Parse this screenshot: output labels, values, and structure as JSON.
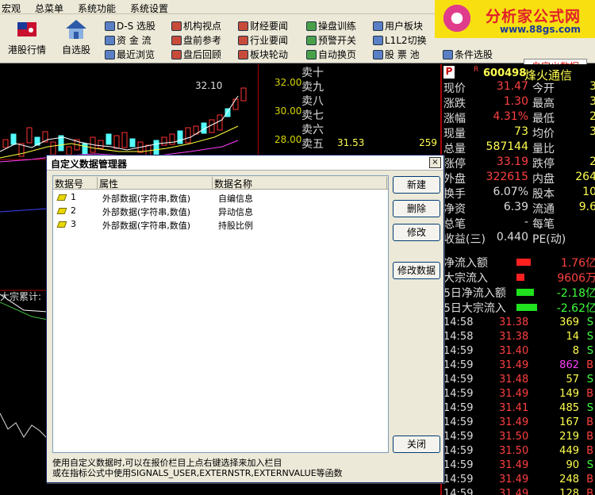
{
  "menu": [
    "宏观",
    "总菜单",
    "系统功能",
    "系统设置"
  ],
  "toolbar": {
    "big": [
      {
        "label": "港股行情",
        "icon": "hk-flag-icon"
      },
      {
        "label": "自选股",
        "icon": "house-icon"
      }
    ],
    "cells": [
      [
        "D-S 选股",
        "机构视点",
        "财经要闻",
        "操盘训练",
        "用户板块"
      ],
      [
        "资 金 流",
        "盘前参考",
        "行业要闻",
        "预警开关",
        "L1L2切换"
      ],
      [
        "最近浏览",
        "盘后回顾",
        "板块轮动",
        "自动换页",
        "股 票 池"
      ]
    ],
    "conditional": "条件选股",
    "custom": "自定义数据"
  },
  "logo": {
    "main": "分析家公式网",
    "url": "www.88gs.com"
  },
  "chart": {
    "price_labels": [
      "32.00",
      "30.00",
      "28.00"
    ],
    "peak_label": "32.10",
    "side_label": "大宗累计:"
  },
  "orderbook": {
    "levels": [
      "卖十",
      "卖九",
      "卖八",
      "卖七",
      "卖六",
      "卖五"
    ],
    "sell5_price": "31.53",
    "sell5_vol": "259"
  },
  "quote": {
    "badge": "P",
    "r": "R",
    "code": "600498",
    "name": "烽火通信",
    "rows": [
      {
        "k": "现价",
        "v": "31.47",
        "c": "#ff4040",
        "k2": "今开",
        "v2": "3"
      },
      {
        "k": "涨跌",
        "v": "1.30",
        "c": "#ff4040",
        "k2": "最高",
        "v2": "3"
      },
      {
        "k": "涨幅",
        "v": "4.31%",
        "c": "#ff4040",
        "k2": "最低",
        "v2": "2"
      },
      {
        "k": "现量",
        "v": "73",
        "c": "#ffff50",
        "k2": "均价",
        "v2": "3"
      },
      {
        "k": "总量",
        "v": "587144",
        "c": "#ffff50",
        "k2": "量比",
        "v2": ""
      },
      {
        "k": "涨停",
        "v": "33.19",
        "c": "#ff4040",
        "k2": "跌停",
        "v2": "2"
      },
      {
        "k": "外盘",
        "v": "322615",
        "c": "#ff4040",
        "k2": "内盘",
        "v2": "264"
      }
    ],
    "rows2": [
      {
        "k": "换手",
        "v": "6.07%",
        "c": "#ddd",
        "k2": "股本",
        "v2": "10"
      },
      {
        "k": "净资",
        "v": "6.39",
        "c": "#ddd",
        "k2": "流通",
        "v2": "9.6"
      },
      {
        "k": "总笔",
        "v": "-",
        "c": "#ddd",
        "k2": "每笔",
        "v2": ""
      },
      {
        "k": "收益(三)",
        "v": "0.440",
        "c": "#ddd",
        "k2": "PE(动)",
        "v2": ""
      }
    ],
    "flows": [
      {
        "k": "净流入额",
        "v": "1.76亿",
        "c": "#ff4040",
        "bar": "#ff2020",
        "w": 18
      },
      {
        "k": "大宗流入",
        "v": "9606万",
        "c": "#ff4040",
        "bar": "#ff2020",
        "w": 10
      },
      {
        "k": "5日净流入额",
        "v": "-2.18亿",
        "c": "#40ff40",
        "bar": "#20e020",
        "w": 22
      },
      {
        "k": "5日大宗流入",
        "v": "-2.62亿",
        "c": "#40ff40",
        "bar": "#20e020",
        "w": 26
      }
    ],
    "ticks": [
      {
        "t": "14:58",
        "p": "31.38",
        "q": "369",
        "s": "S"
      },
      {
        "t": "14:58",
        "p": "31.38",
        "q": "14",
        "s": "S"
      },
      {
        "t": "14:59",
        "p": "31.40",
        "q": "8",
        "s": "S"
      },
      {
        "t": "14:59",
        "p": "31.49",
        "q": "862",
        "s": "B"
      },
      {
        "t": "14:59",
        "p": "31.48",
        "q": "57",
        "s": "S"
      },
      {
        "t": "14:59",
        "p": "31.49",
        "q": "149",
        "s": "B"
      },
      {
        "t": "14:59",
        "p": "31.41",
        "q": "485",
        "s": "S"
      },
      {
        "t": "14:59",
        "p": "31.49",
        "q": "167",
        "s": "B"
      },
      {
        "t": "14:59",
        "p": "31.50",
        "q": "219",
        "s": "B"
      },
      {
        "t": "14:59",
        "p": "31.50",
        "q": "449",
        "s": "B"
      },
      {
        "t": "14:59",
        "p": "31.49",
        "q": "90",
        "s": "S"
      },
      {
        "t": "14:59",
        "p": "31.49",
        "q": "248",
        "s": "B"
      },
      {
        "t": "14:59",
        "p": "31.49",
        "q": "128",
        "s": "B"
      }
    ]
  },
  "dialog": {
    "title": "自定义数据管理器",
    "close": "×",
    "headers": [
      "数据号",
      "属性",
      "数据名称"
    ],
    "rows": [
      {
        "num": "1",
        "attr": "外部数据(字符串,数值)",
        "name": "自编信息"
      },
      {
        "num": "2",
        "attr": "外部数据(字符串,数值)",
        "name": "异动信息"
      },
      {
        "num": "3",
        "attr": "外部数据(字符串,数值)",
        "name": "持股比例"
      }
    ],
    "buttons": {
      "new": "新建",
      "delete": "删除",
      "modify": "修改",
      "modify_data": "修改数据",
      "close": "关闭"
    },
    "info1": "使用自定义数据时,可以在报价栏目上点右键选择来加入栏目",
    "info2": "或在指标公式中使用SIGNALS_USER,EXTERNSTR,EXTERNVALUE等函数"
  }
}
